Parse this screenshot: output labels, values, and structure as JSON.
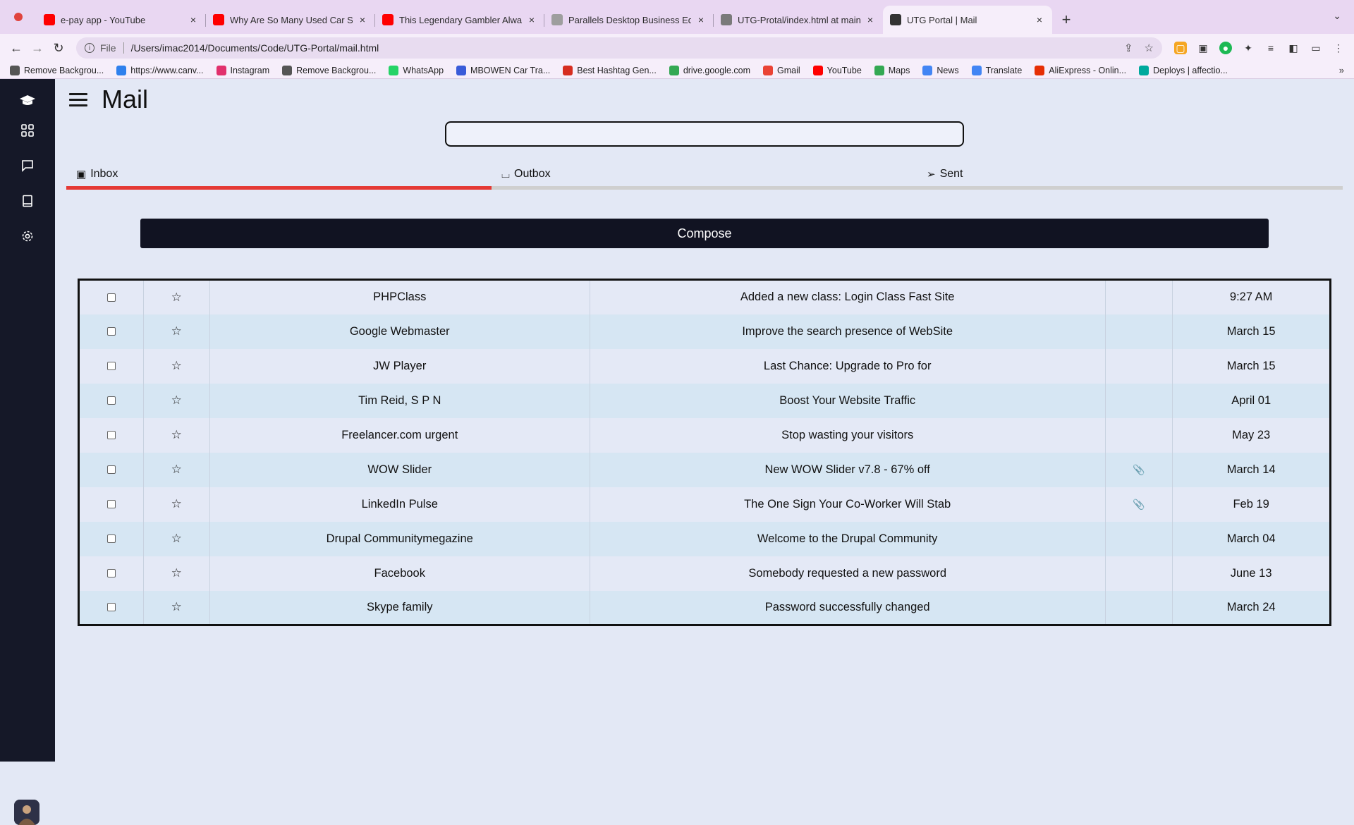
{
  "browser": {
    "tabs": [
      {
        "title": "e-pay app - YouTube",
        "favicon_color": "#ff0000"
      },
      {
        "title": "Why Are So Many Used Car St",
        "favicon_color": "#ff0000"
      },
      {
        "title": "This Legendary Gambler Alway",
        "favicon_color": "#ff0000"
      },
      {
        "title": "Parallels Desktop Business Edi",
        "favicon_color": "#9e9e9e"
      },
      {
        "title": "UTG-Protal/index.html at main",
        "favicon_color": "#7a7a7a"
      },
      {
        "title": "UTG Portal | Mail",
        "favicon_color": "#333333"
      }
    ],
    "active_tab_index": 5,
    "address": {
      "scheme_label": "File",
      "url": "/Users/imac2014/Documents/Code/UTG-Portal/mail.html"
    },
    "bookmarks": [
      {
        "label": "Remove Backgrou...",
        "color": "#555555"
      },
      {
        "label": "https://www.canv...",
        "color": "#2f80ed"
      },
      {
        "label": "Instagram",
        "color": "#e1306c"
      },
      {
        "label": "Remove Backgrou...",
        "color": "#555555"
      },
      {
        "label": "WhatsApp",
        "color": "#25d366"
      },
      {
        "label": "MBOWEN Car Tra...",
        "color": "#3a5bd9"
      },
      {
        "label": "Best Hashtag Gen...",
        "color": "#d62d20"
      },
      {
        "label": "drive.google.com",
        "color": "#34a853"
      },
      {
        "label": "Gmail",
        "color": "#ea4335"
      },
      {
        "label": "YouTube",
        "color": "#ff0000"
      },
      {
        "label": "Maps",
        "color": "#34a853"
      },
      {
        "label": "News",
        "color": "#4285f4"
      },
      {
        "label": "Translate",
        "color": "#4285f4"
      },
      {
        "label": "AliExpress - Onlin...",
        "color": "#e62e04"
      },
      {
        "label": "Deploys | affectio...",
        "color": "#00a99d"
      }
    ]
  },
  "app": {
    "title": "Mail",
    "search": {
      "value": "",
      "placeholder": ""
    },
    "tabs": [
      {
        "label": "Inbox",
        "icon": "inbox-icon"
      },
      {
        "label": "Outbox",
        "icon": "outbox-icon"
      },
      {
        "label": "Sent",
        "icon": "send-icon"
      }
    ],
    "active_tab": "Inbox",
    "accent_color": "#e53935",
    "compose_label": "Compose",
    "emails": [
      {
        "sender": "PHPClass",
        "subject": "Added a new class: Login Class Fast Site",
        "attachment": false,
        "date": "9:27 AM"
      },
      {
        "sender": "Google Webmaster",
        "subject": "Improve the search presence of WebSite",
        "attachment": false,
        "date": "March 15"
      },
      {
        "sender": "JW Player",
        "subject": "Last Chance: Upgrade to Pro for",
        "attachment": false,
        "date": "March 15"
      },
      {
        "sender": "Tim Reid, S P N",
        "subject": "Boost Your Website Traffic",
        "attachment": false,
        "date": "April 01"
      },
      {
        "sender": "Freelancer.com urgent",
        "subject": "Stop wasting your visitors",
        "attachment": false,
        "date": "May 23"
      },
      {
        "sender": "WOW Slider",
        "subject": "New WOW Slider v7.8 - 67% off",
        "attachment": true,
        "date": "March 14"
      },
      {
        "sender": "LinkedIn Pulse",
        "subject": "The One Sign Your Co-Worker Will Stab",
        "attachment": true,
        "date": "Feb 19"
      },
      {
        "sender": "Drupal Communitymegazine",
        "subject": "Welcome to the Drupal Community",
        "attachment": false,
        "date": "March 04"
      },
      {
        "sender": "Facebook",
        "subject": "Somebody requested a new password",
        "attachment": false,
        "date": "June 13"
      },
      {
        "sender": "Skype family",
        "subject": "Password successfully changed",
        "attachment": false,
        "date": "March 24"
      }
    ]
  }
}
